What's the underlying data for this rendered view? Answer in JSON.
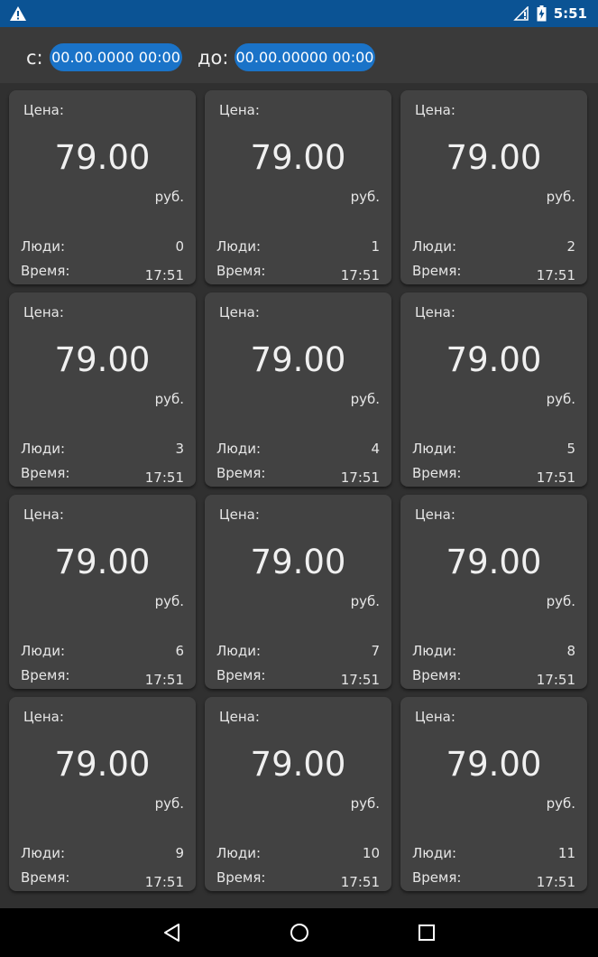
{
  "status_bar": {
    "time": "5:51",
    "icons": [
      "warning-icon",
      "signal-icon",
      "battery-icon"
    ]
  },
  "filter": {
    "from_label": "с:",
    "from_value": "00.00.0000 00:00",
    "to_label": "до:",
    "to_value": "00.00.00000 00:00",
    "accent_color": "#1a73c8"
  },
  "cards": [
    {
      "price_label": "Цена:",
      "price": "79.00",
      "currency": "руб.",
      "people_label": "Люди:",
      "people": "0",
      "time_label": "Время:",
      "time": "17:51"
    },
    {
      "price_label": "Цена:",
      "price": "79.00",
      "currency": "руб.",
      "people_label": "Люди:",
      "people": "1",
      "time_label": "Время:",
      "time": "17:51"
    },
    {
      "price_label": "Цена:",
      "price": "79.00",
      "currency": "руб.",
      "people_label": "Люди:",
      "people": "2",
      "time_label": "Время:",
      "time": "17:51"
    },
    {
      "price_label": "Цена:",
      "price": "79.00",
      "currency": "руб.",
      "people_label": "Люди:",
      "people": "3",
      "time_label": "Время:",
      "time": "17:51"
    },
    {
      "price_label": "Цена:",
      "price": "79.00",
      "currency": "руб.",
      "people_label": "Люди:",
      "people": "4",
      "time_label": "Время:",
      "time": "17:51"
    },
    {
      "price_label": "Цена:",
      "price": "79.00",
      "currency": "руб.",
      "people_label": "Люди:",
      "people": "5",
      "time_label": "Время:",
      "time": "17:51"
    },
    {
      "price_label": "Цена:",
      "price": "79.00",
      "currency": "руб.",
      "people_label": "Люди:",
      "people": "6",
      "time_label": "Время:",
      "time": "17:51"
    },
    {
      "price_label": "Цена:",
      "price": "79.00",
      "currency": "руб.",
      "people_label": "Люди:",
      "people": "7",
      "time_label": "Время:",
      "time": "17:51"
    },
    {
      "price_label": "Цена:",
      "price": "79.00",
      "currency": "руб.",
      "people_label": "Люди:",
      "people": "8",
      "time_label": "Время:",
      "time": "17:51"
    },
    {
      "price_label": "Цена:",
      "price": "79.00",
      "currency": "руб.",
      "people_label": "Люди:",
      "people": "9",
      "time_label": "Время:",
      "time": "17:51"
    },
    {
      "price_label": "Цена:",
      "price": "79.00",
      "currency": "руб.",
      "people_label": "Люди:",
      "people": "10",
      "time_label": "Время:",
      "time": "17:51"
    },
    {
      "price_label": "Цена:",
      "price": "79.00",
      "currency": "руб.",
      "people_label": "Люди:",
      "people": "11",
      "time_label": "Время:",
      "time": "17:51"
    }
  ],
  "nav_bar": {
    "buttons": [
      "back-icon",
      "home-icon",
      "recents-icon"
    ]
  }
}
